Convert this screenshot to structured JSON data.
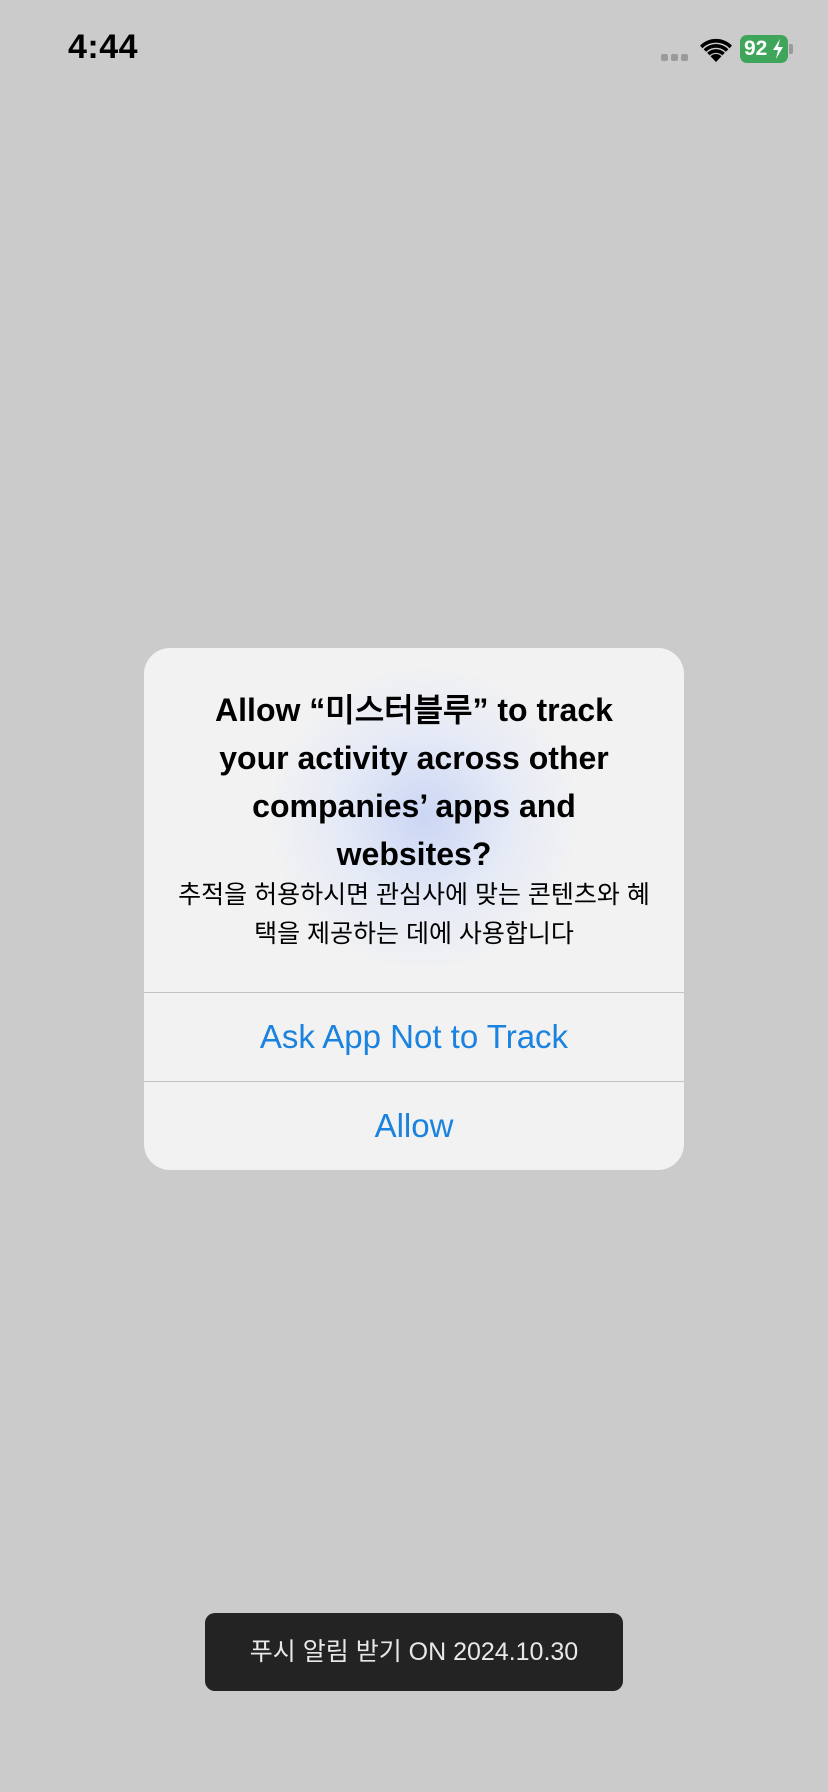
{
  "status_bar": {
    "time": "4:44",
    "battery_level": "92",
    "icons": [
      "cellular-signal-icon",
      "wifi-icon",
      "battery-charging-icon"
    ]
  },
  "alert": {
    "title": "Allow “미스터블루” to track your activity across other companies’ apps and websites?",
    "message": "추적을 허용하시면 관심사에 맞는 콘텐츠와 혜택을 제공하는 데에 사용합니다",
    "buttons": [
      {
        "label": "Ask App Not to Track"
      },
      {
        "label": "Allow"
      }
    ]
  },
  "toast": {
    "text": "푸시 알림 받기 ON 2024.10.30"
  },
  "colors": {
    "background": "#cbcbcb",
    "alert_background": "#f2f2f2",
    "button_text": "#1a82df",
    "battery": "#3fa55a",
    "toast_background": "#232323"
  }
}
